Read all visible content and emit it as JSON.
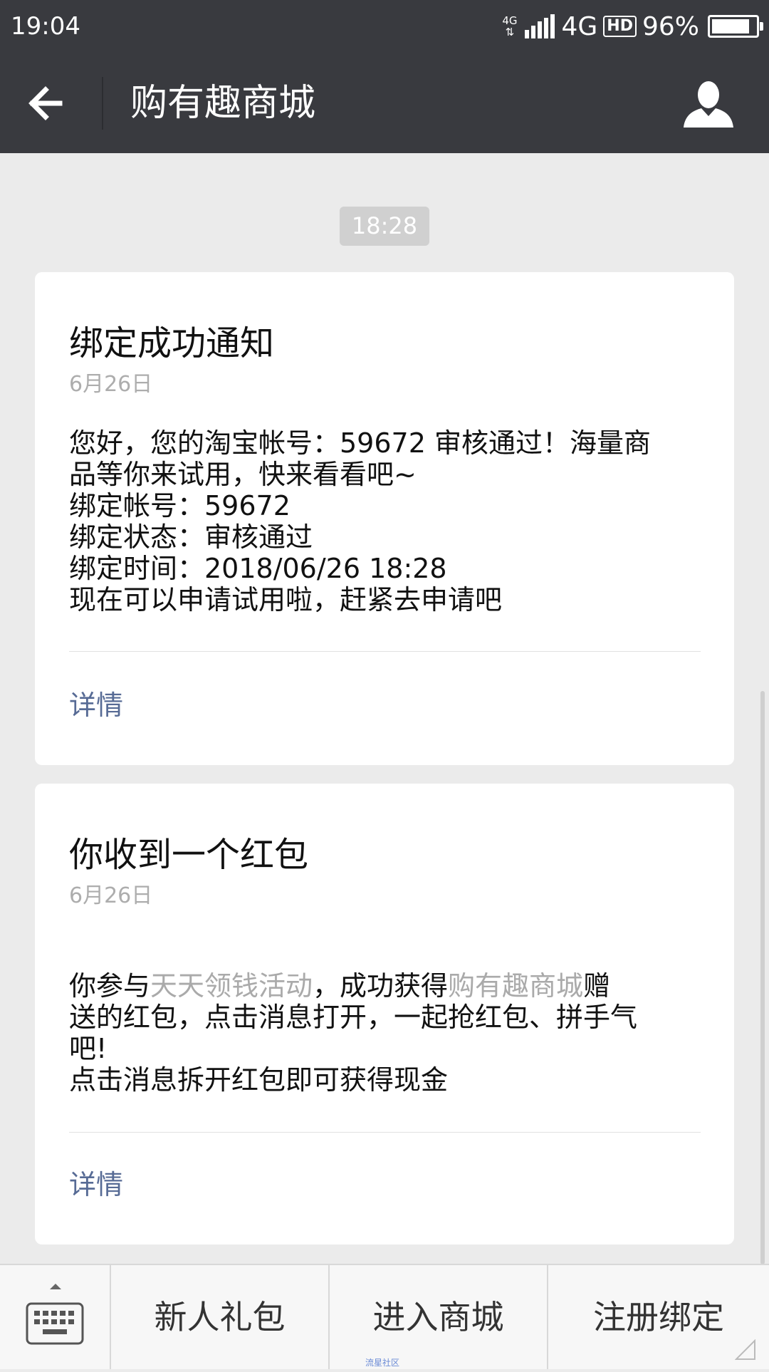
{
  "status_bar": {
    "time": "19:04",
    "net_top": "4G",
    "net_bottom": "⇅",
    "network": "4G",
    "hd": "HD",
    "battery": "96%",
    "battery_level": 0.96
  },
  "header": {
    "title": "购有趣商城",
    "back_icon": "back-arrow-icon",
    "profile_icon": "person-icon"
  },
  "timestamp": "18:28",
  "messages": [
    {
      "title": "绑定成功通知",
      "date": "6月26日",
      "body_lines": [
        "您好，您的淘宝帐号：59672 审核通过！海量商",
        "品等你来试用，快来看看吧~",
        "绑定帐号：59672",
        "绑定状态：审核通过",
        "绑定时间：2018/06/26 18:28",
        "现在可以申请试用啦，赶紧去申请吧"
      ],
      "detail_label": "详情"
    },
    {
      "title": "你收到一个红包",
      "date": "6月26日",
      "body": {
        "part1": "你参与",
        "activity": "天天领钱活动",
        "part2": "，成功获得",
        "store": "购有趣商城",
        "part3": "赠",
        "line2": "送的红包，点击消息打开，一起抢红包、拼手气",
        "line3": "吧!",
        "line4": "点击消息拆开红包即可获得现金"
      },
      "detail_label": "详情"
    }
  ],
  "bottom_menu": {
    "keyboard_icon": "keyboard-icon",
    "items": [
      "新人礼包",
      "进入商城",
      "注册绑定"
    ]
  },
  "watermark": "流星社区",
  "colors": {
    "header_bg": "#393a3f",
    "page_bg": "#ebebeb",
    "link": "#576b95",
    "muted_text": "#aaaaaa"
  }
}
